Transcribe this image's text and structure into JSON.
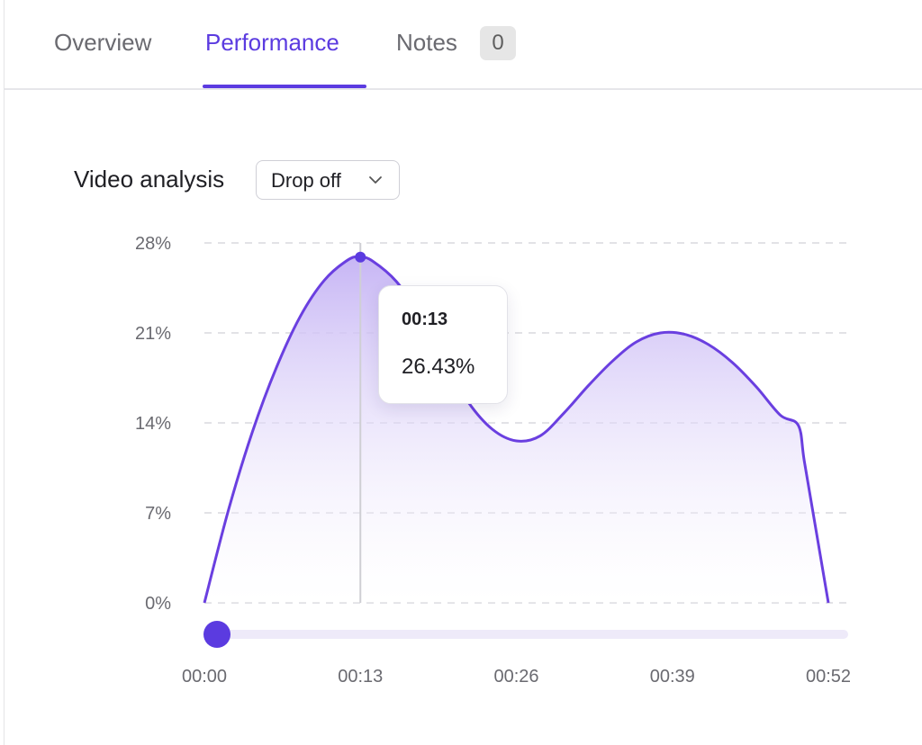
{
  "tabs": [
    {
      "label": "Overview",
      "active": false
    },
    {
      "label": "Performance",
      "active": true
    },
    {
      "label": "Notes",
      "active": false,
      "badge": "0"
    }
  ],
  "section": {
    "title": "Video analysis"
  },
  "dropdown": {
    "selected": "Drop off"
  },
  "tooltip": {
    "time": "00:13",
    "value": "26.43%"
  },
  "colors": {
    "accent": "#5b3be0",
    "line": "#6a3fe0",
    "fill_top": "#c9b8f5",
    "grid": "#d9d9de"
  },
  "chart_data": {
    "type": "area",
    "title": "",
    "xlabel": "",
    "ylabel": "",
    "ylim": [
      0,
      28
    ],
    "yticks": [
      "0%",
      "7%",
      "14%",
      "21%",
      "28%"
    ],
    "xticks": [
      "00:00",
      "00:13",
      "00:26",
      "00:39",
      "00:52"
    ],
    "xlim": [
      0,
      52
    ],
    "grid": "horizontal dashed",
    "series": [
      {
        "x": [
          0,
          2,
          4,
          6,
          8,
          10,
          12,
          13,
          14,
          16,
          18,
          20,
          22,
          24,
          26,
          28,
          30,
          32,
          34,
          36,
          38,
          40,
          42,
          44,
          46,
          48,
          49.5,
          50,
          51,
          52
        ],
        "y": [
          0,
          7.2,
          13.3,
          18.3,
          22.3,
          25.1,
          26.7,
          26.9,
          26.6,
          25.0,
          22.3,
          18.8,
          15.6,
          13.5,
          12.6,
          13.0,
          14.8,
          16.9,
          18.8,
          20.3,
          21.0,
          20.9,
          20.1,
          18.7,
          16.8,
          14.6,
          13.8,
          11.0,
          5.5,
          0
        ]
      }
    ],
    "highlight": {
      "x": 13,
      "y": 26.43,
      "label_time": "00:13",
      "label_value": "26.43%"
    },
    "scrubber": {
      "position": 0.0
    }
  }
}
